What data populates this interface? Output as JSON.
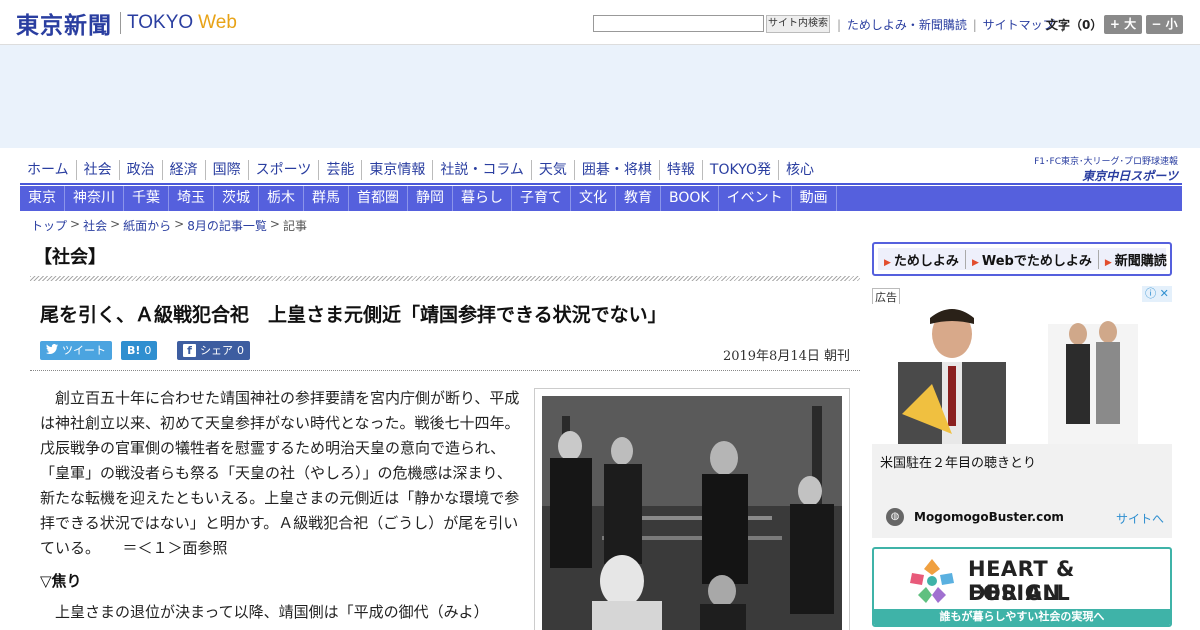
{
  "header": {
    "logo_jp": "東京新聞",
    "logo_tokyo": "TOKYO",
    "logo_web": "Web",
    "search_button": "サイト内検索",
    "links": [
      "ためしよみ・新聞購読",
      "サイトマップ"
    ],
    "font_label": "文字（0）",
    "font_bigger": "+ 大",
    "font_smaller": "− 小"
  },
  "nav_primary": [
    "ホーム",
    "社会",
    "政治",
    "経済",
    "国際",
    "スポーツ",
    "芸能",
    "東京情報",
    "社説・コラム",
    "天気",
    "囲碁・将棋",
    "特報",
    "TOKYO発",
    "核心"
  ],
  "chunichi": {
    "line1": "F1･FC東京･大リーグ･プロ野球速報",
    "line2": "東京中日スポーツ"
  },
  "nav_secondary": [
    "東京",
    "神奈川",
    "千葉",
    "埼玉",
    "茨城",
    "栃木",
    "群馬",
    "首都圏",
    "静岡",
    "暮らし",
    "子育て",
    "文化",
    "教育",
    "BOOK",
    "イベント",
    "動画"
  ],
  "breadcrumb": [
    "トップ",
    "社会",
    "紙面から",
    "8月の記事一覧"
  ],
  "breadcrumb_current": "記事",
  "section_title": "【社会】",
  "article": {
    "headline": "尾を引く、Ａ級戦犯合祀　上皇さま元側近「靖国参拝できる状況でない」",
    "tweet": "ツイート",
    "hatena_count": "0",
    "share_label": "シェア",
    "share_count": "0",
    "date": "2019年8月14日 朝刊",
    "lead": "創立百五十年に合わせた靖国神社の参拝要請を宮内庁側が断り、平成は神社創立以来、初めて天皇参拝がない時代となった。戦後七十四年。戊辰戦争の官軍側の犠牲者を慰霊するため明治天皇の意向で造られ、「皇軍」の戦没者らも祭る「天皇の社（やしろ）」の危機感は深まり、新たな転機を迎えたともいえる。上皇さまの元側近は「静かな環境で参拝できる状況ではない」と明かす。Ａ級戦犯合祀（ごうし）が尾を引いている。　　＝＜１＞面参照",
    "subhead": "▽焦り",
    "para2": "上皇さまの退位が決まって以降、靖国側は「平成の御代（みよ）"
  },
  "sidebar": {
    "promo": [
      "ためしよみ",
      "Webでためしよみ",
      "新聞購読"
    ],
    "ad_label": "広告",
    "ad_title": "米国駐在２年目の聴きとり",
    "ad_source": "MogomogoBuster.com",
    "ad_site_link": "サイトへ",
    "banner_line1": "HEART & DESIGN",
    "banner_line2": "FOR ALL",
    "banner_tagline": "誰もが暮らしやすい社会の実現へ"
  }
}
